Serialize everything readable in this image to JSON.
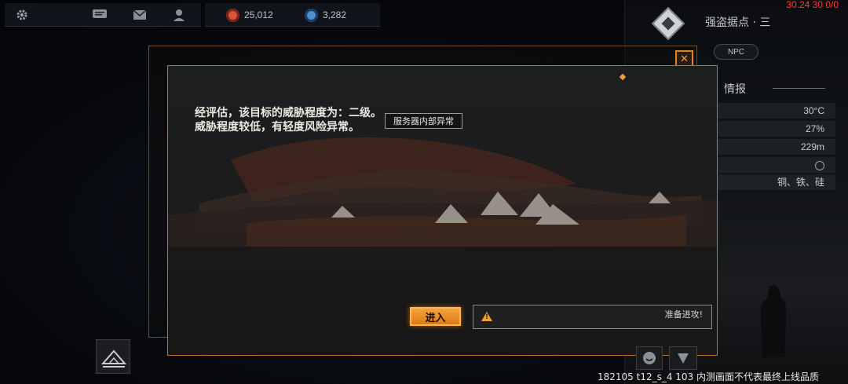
{
  "topbar": {
    "icons": [
      "gear-icon",
      "chat-icon",
      "mail-icon",
      "person-icon"
    ],
    "resource1": {
      "value": "25,012",
      "color": "#d9553a"
    },
    "resource2": {
      "value": "3,282",
      "color": "#4d8fd0"
    }
  },
  "debug": {
    "text": "30.24 30 0/0"
  },
  "location": {
    "title": "强盗据点 · 三",
    "badge": "NPC"
  },
  "info": {
    "title": "情报",
    "rows": [
      "30°C",
      "27%",
      "229m",
      "",
      "铜、铁、硅"
    ]
  },
  "modal": {
    "eval_line1": "经评估，该目标的威胁程度为：二级。",
    "eval_line2": "威胁程度较低，有轻度风险异常。",
    "tooltip": "服务器内部异常",
    "enter_label": "进入",
    "warn_symbol": "!",
    "warn_text": "准备进攻!",
    "close_symbol": "✕"
  },
  "footer": {
    "note": "182105 t12_s_4 103  内测画面不代表最终上线品质"
  },
  "colors": {
    "accent": "#f0a030",
    "border": "#b27a2e",
    "danger": "#ff3b30"
  }
}
